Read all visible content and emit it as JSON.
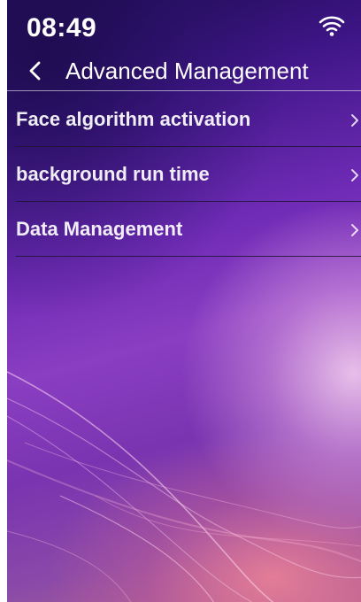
{
  "status_bar": {
    "time": "08:49",
    "wifi_icon": "wifi-icon"
  },
  "header": {
    "back_icon": "chevron-left-icon",
    "title": "Advanced Management"
  },
  "menu": {
    "items": [
      {
        "label": "Face algorithm activation",
        "icon": "chevron-right-icon"
      },
      {
        "label": "background run time",
        "icon": "chevron-right-icon"
      },
      {
        "label": "Data Management",
        "icon": "chevron-right-icon"
      }
    ]
  }
}
